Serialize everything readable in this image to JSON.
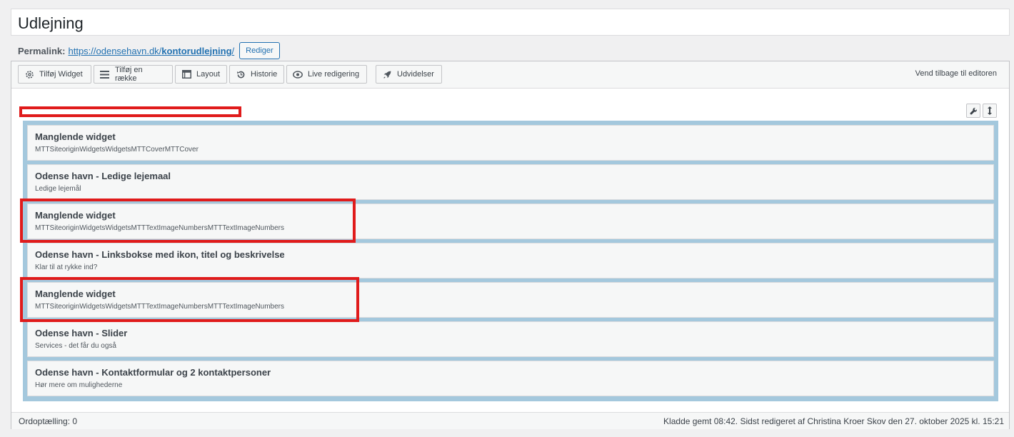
{
  "page": {
    "title": "Udlejning"
  },
  "permalink": {
    "label": "Permalink:",
    "url_prefix": "https://odensehavn.dk/",
    "url_slug": "kontorudlejning",
    "url_suffix": "/",
    "edit_label": "Rediger"
  },
  "toolbar": {
    "buttons": [
      {
        "label": "Tilføj Widget",
        "icon": "gear-icon"
      },
      {
        "label": "Tilføj en række",
        "icon": "rows-icon"
      },
      {
        "label": "Layout",
        "icon": "layout-icon"
      },
      {
        "label": "Historie",
        "icon": "history-icon"
      },
      {
        "label": "Live redigering",
        "icon": "eye-icon"
      },
      {
        "label": "Udvidelser",
        "icon": "rocket-icon"
      }
    ],
    "back_link": "Vend tilbage til editoren"
  },
  "widgets": [
    {
      "title": "Manglende widget",
      "desc": "MTTSiteoriginWidgetsWidgetsMTTCoverMTTCover",
      "highlighted": true
    },
    {
      "title": "Odense havn - Ledige lejemaal",
      "desc": "Ledige lejemål",
      "highlighted": false
    },
    {
      "title": "Manglende widget",
      "desc": "MTTSiteoriginWidgetsWidgetsMTTTextImageNumbersMTTTextImageNumbers",
      "highlighted": true
    },
    {
      "title": "Odense havn - Linksbokse med ikon, titel og beskrivelse",
      "desc": "Klar til at rykke ind?",
      "highlighted": false
    },
    {
      "title": "Manglende widget",
      "desc": "MTTSiteoriginWidgetsWidgetsMTTTextImageNumbersMTTTextImageNumbers",
      "highlighted": true
    },
    {
      "title": "Odense havn - Slider",
      "desc": "Services - det får du også",
      "highlighted": false
    },
    {
      "title": "Odense havn - Kontaktformular og 2 kontaktpersoner",
      "desc": "Hør mere om mulighederne",
      "highlighted": false
    }
  ],
  "status": {
    "word_count": "Ordoptælling: 0",
    "saved": "Kladde gemt 08:42. Sidst redigeret af Christina Kroer Skov den 27. oktober 2025 kl. 15:21"
  },
  "colors": {
    "highlight": "#e01b1b",
    "cell_bg": "#a4c8dd",
    "link": "#2271b1"
  }
}
